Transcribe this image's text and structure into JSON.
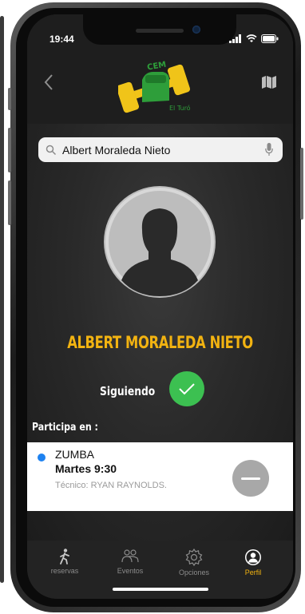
{
  "status": {
    "time": "19:44"
  },
  "header": {
    "logo_top_text": "CEM",
    "logo_bottom_text": "El Turó"
  },
  "search": {
    "value": "Albert Moraleda Nieto"
  },
  "profile": {
    "name": "ALBERT MORALEDA NIETO",
    "follow_label": "Siguiendo"
  },
  "participa": {
    "heading": "Participa en :",
    "items": [
      {
        "activity": "ZUMBA",
        "schedule": "Martes 9:30",
        "trainer": "Técnico: RYAN RAYNOLDS."
      }
    ]
  },
  "tabs": [
    {
      "label": "reservas",
      "icon": "walking-person-icon",
      "active": false
    },
    {
      "label": "Eventos",
      "icon": "group-icon",
      "active": false
    },
    {
      "label": "Opciones",
      "icon": "gear-icon",
      "active": false
    },
    {
      "label": "Perfil",
      "icon": "user-circle-icon",
      "active": true
    }
  ],
  "colors": {
    "accent": "#f2b311",
    "follow_green": "#3cc051",
    "dot_blue": "#1e82f0",
    "header_bg": "#1e1e1e"
  }
}
